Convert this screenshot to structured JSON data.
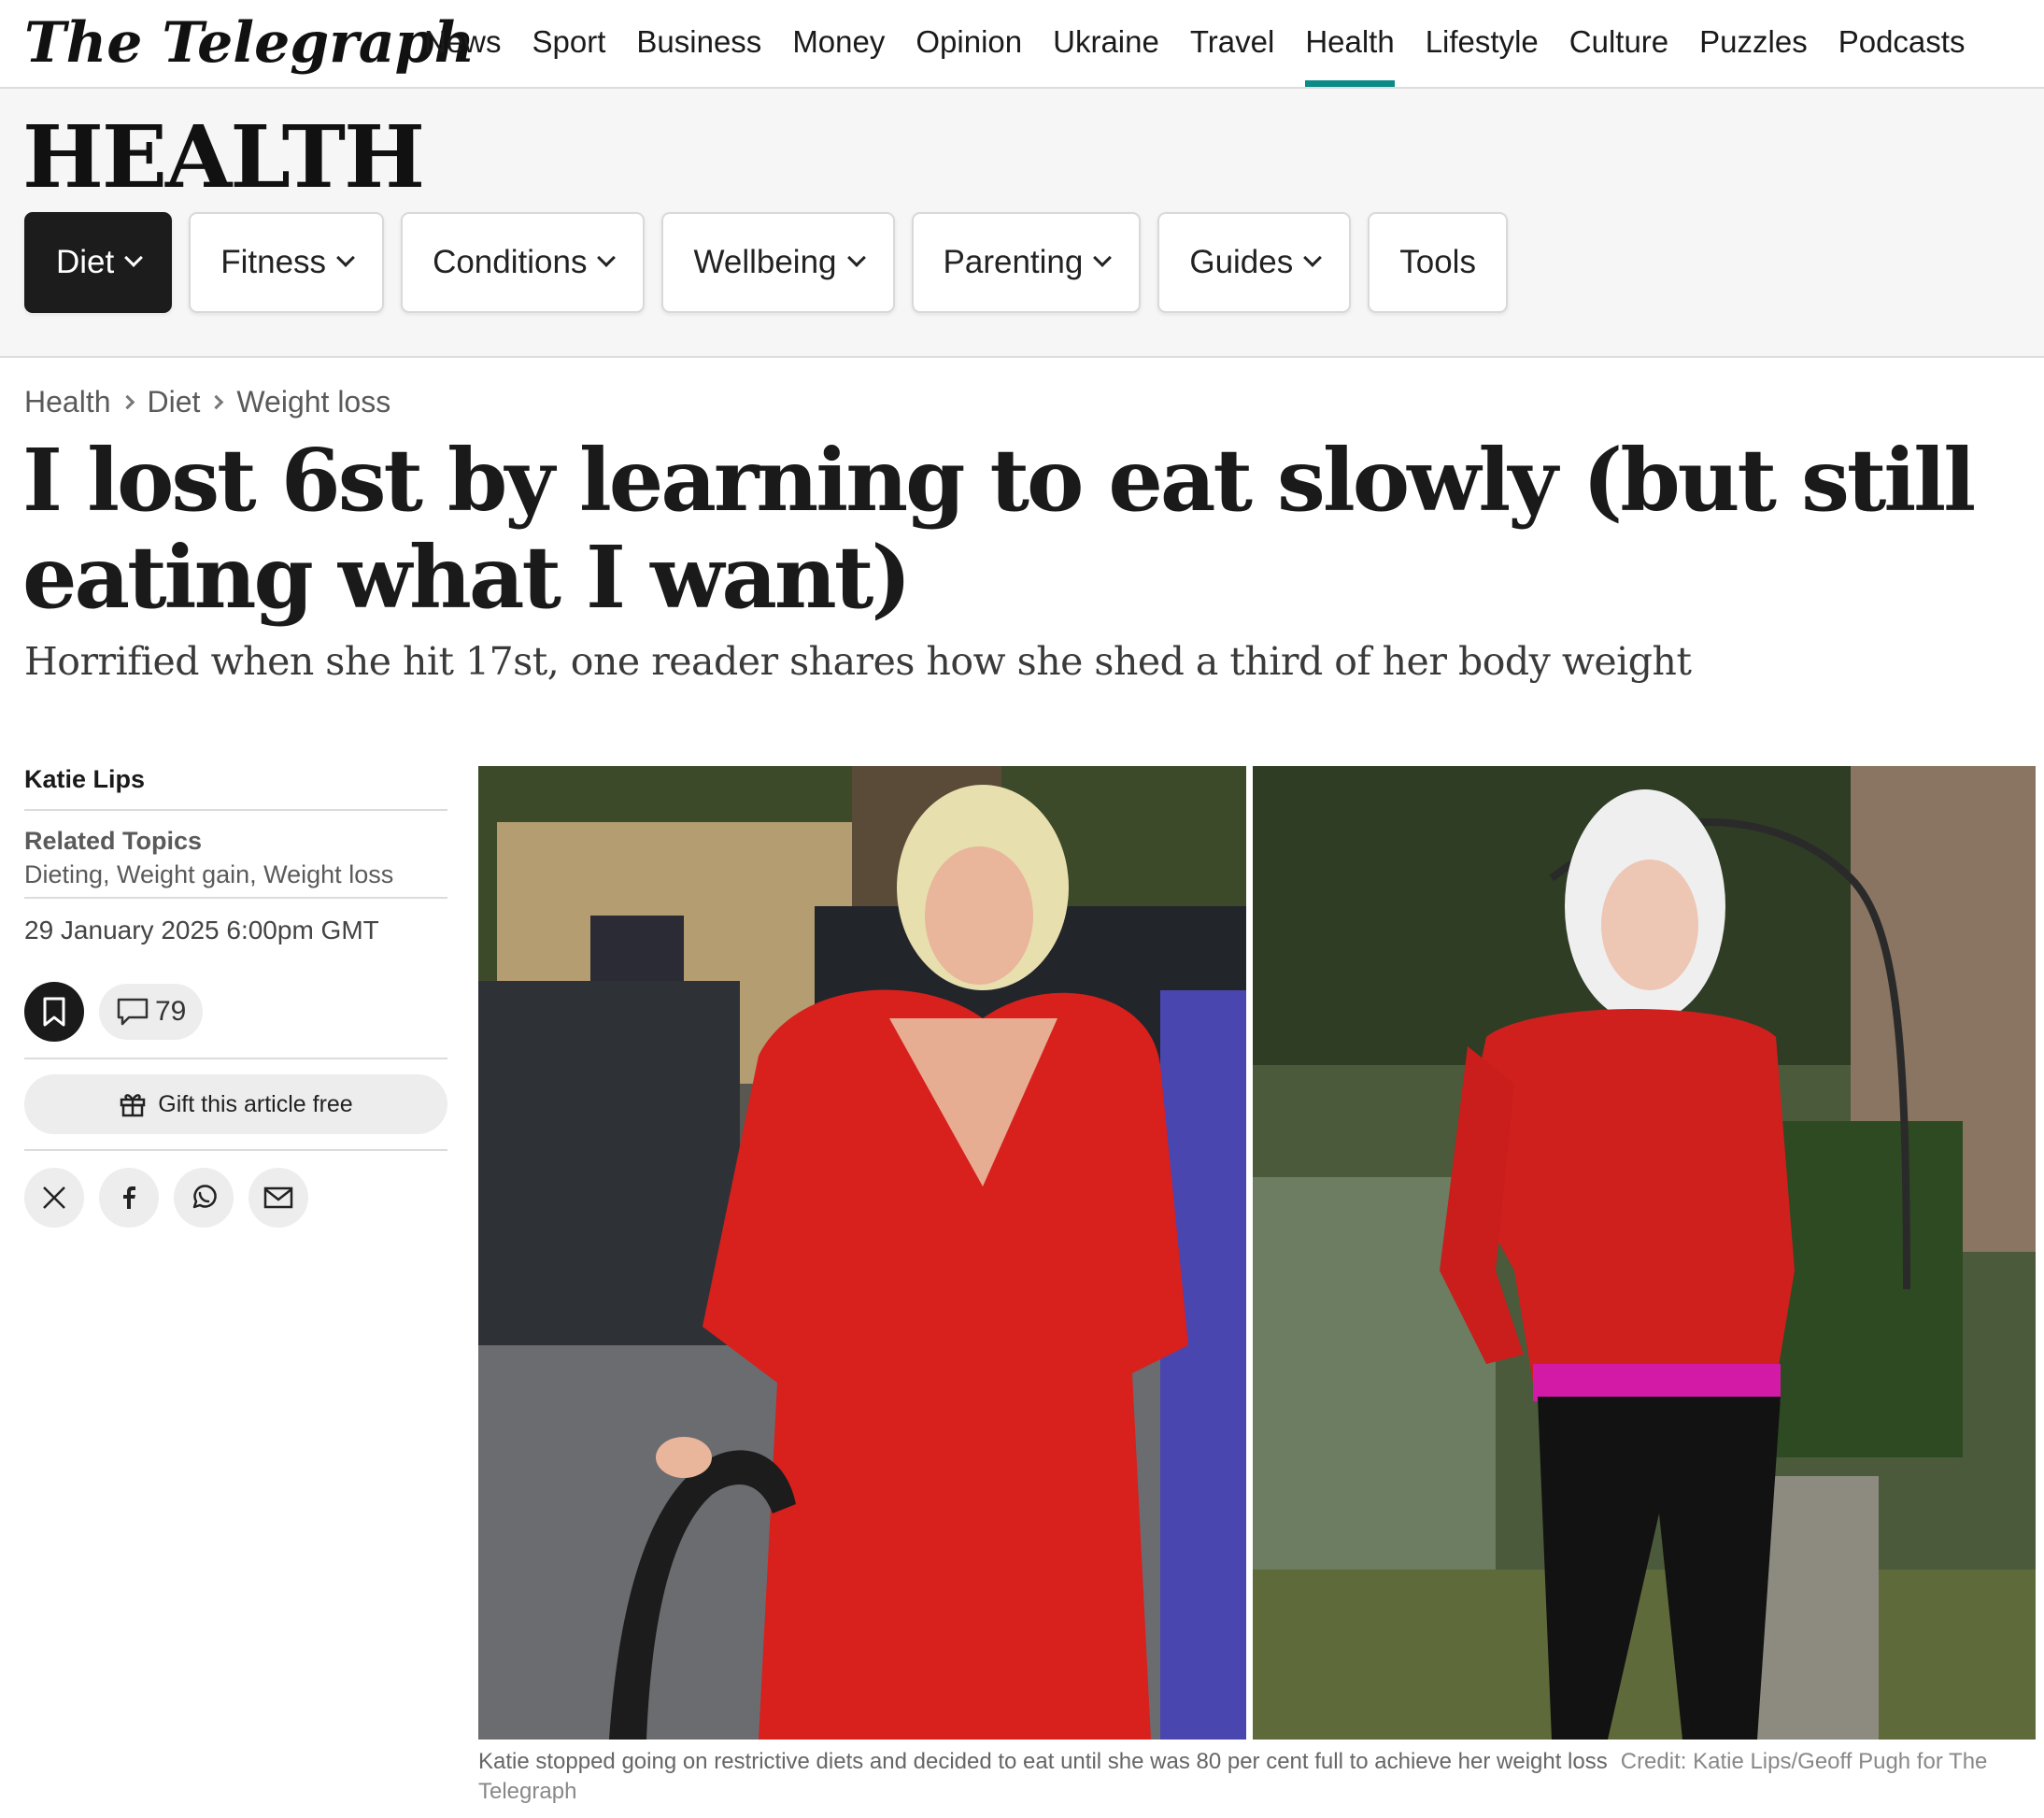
{
  "brand": {
    "logo_text": "The Telegraph"
  },
  "topnav": {
    "links": [
      "News",
      "Sport",
      "Business",
      "Money",
      "Opinion",
      "Ukraine",
      "Travel",
      "Health",
      "Lifestyle",
      "Culture",
      "Puzzles",
      "Podcasts"
    ],
    "active": "Health",
    "accent_color": "#0b8a86"
  },
  "section": {
    "title": "HEALTH",
    "chips": [
      {
        "label": "Diet",
        "dropdown": true,
        "active": true
      },
      {
        "label": "Fitness",
        "dropdown": true
      },
      {
        "label": "Conditions",
        "dropdown": true
      },
      {
        "label": "Wellbeing",
        "dropdown": true
      },
      {
        "label": "Parenting",
        "dropdown": true
      },
      {
        "label": "Guides",
        "dropdown": true
      },
      {
        "label": "Tools",
        "dropdown": false
      }
    ]
  },
  "breadcrumb": [
    "Health",
    "Diet",
    "Weight loss"
  ],
  "article": {
    "headline": "I lost 6st by learning to eat slowly (but still eating what I want)",
    "standfirst": "Horrified when she hit 17st, one reader shares how she shed a third of her body weight",
    "author": "Katie Lips",
    "related_topics_label": "Related Topics",
    "related_topics": "Dieting, Weight gain, Weight loss",
    "date": "29 January 2025 6:00pm GMT",
    "comment_count": "79",
    "gift_label": "Gift this article free",
    "share_icons": [
      "x-icon",
      "facebook-icon",
      "whatsapp-icon",
      "email-icon"
    ],
    "caption": "Katie stopped going on restrictive diets and decided to eat until she was 80 per cent full to achieve her weight loss",
    "credit": "Credit: Katie Lips/Geoff Pugh for The Telegraph"
  }
}
